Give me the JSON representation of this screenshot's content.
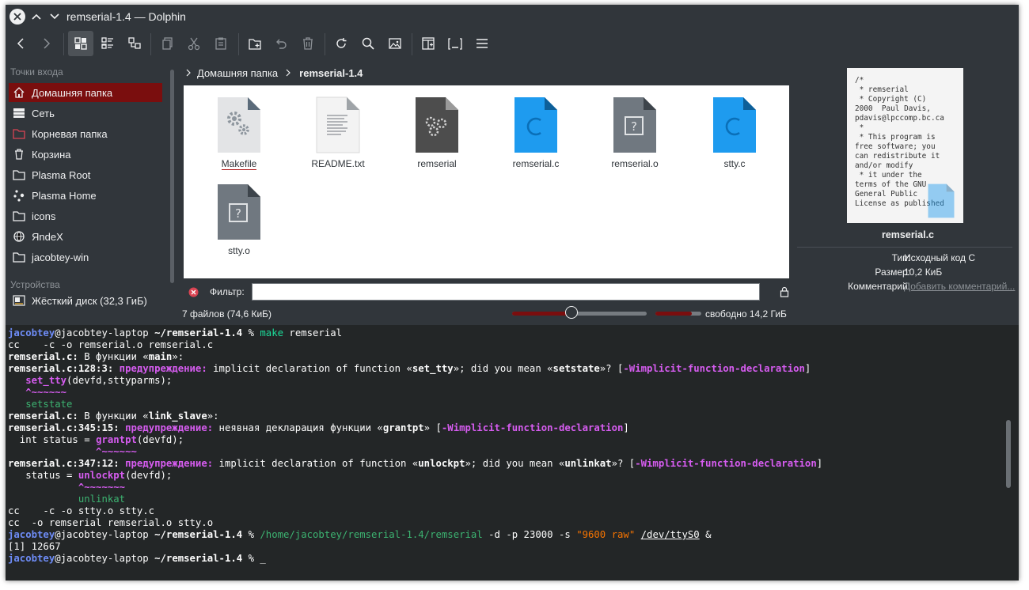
{
  "window": {
    "title": "remserial-1.4 — Dolphin"
  },
  "sidebar": {
    "places_header": "Точки входа",
    "places": [
      {
        "label": "Домашняя папка",
        "icon": "home-icon",
        "selected": true
      },
      {
        "label": "Сеть",
        "icon": "network-icon"
      },
      {
        "label": "Корневая папка",
        "icon": "root-folder-icon"
      },
      {
        "label": "Корзина",
        "icon": "trash-icon"
      },
      {
        "label": "Plasma Root",
        "icon": "folder-icon"
      },
      {
        "label": "Plasma Home",
        "icon": "plasma-icon"
      },
      {
        "label": "icons",
        "icon": "folder-icon"
      },
      {
        "label": "ЯndeX",
        "icon": "network-folder-icon"
      },
      {
        "label": "jacobtey-win",
        "icon": "folder-icon"
      }
    ],
    "devices_header": "Устройства",
    "devices": [
      {
        "label": "Жёсткий диск (32,3 ГиБ)",
        "icon": "hard-disk-icon"
      }
    ]
  },
  "breadcrumb": {
    "items": [
      "Домашняя папка",
      "remserial-1.4"
    ]
  },
  "files": [
    {
      "name": "Makefile",
      "icon": "makefile-icon"
    },
    {
      "name": "README.txt",
      "icon": "text-file-icon"
    },
    {
      "name": "remserial",
      "icon": "executable-icon"
    },
    {
      "name": "remserial.c",
      "icon": "c-source-icon"
    },
    {
      "name": "remserial.o",
      "icon": "unknown-file-icon"
    },
    {
      "name": "stty.c",
      "icon": "c-source-icon"
    },
    {
      "name": "stty.o",
      "icon": "unknown-file-icon"
    }
  ],
  "filter": {
    "label": "Фильтр:",
    "value": ""
  },
  "status": {
    "summary": "7 файлов (74,6 КиБ)",
    "free": "свободно 14,2 ГиБ",
    "zoom_fraction": 0.44
  },
  "info": {
    "preview_text": "/*\n * remserial\n * Copyright (C)\n2000  Paul Davis,\npdavis@lpccomp.bc.ca\n *\n * This program is\nfree software; you\ncan redistribute it\nand/or modify\n * it under the\nterms of the GNU\nGeneral Public\nLicense as published",
    "filename": "remserial.c",
    "rows": [
      {
        "label": "Тип:",
        "value": "Исходный код C"
      },
      {
        "label": "Размер:",
        "value": "10,2 КиБ"
      },
      {
        "label": "Комментарий:",
        "value": "Добавить комментарий..."
      }
    ]
  },
  "terminal": {
    "user": "jacobtey",
    "host": "@jacobtey-laptop",
    "dir": "~/remserial-1.4",
    "cmd1": "make",
    "cmd1_arg": " remserial",
    "lines": [
      "cc    -c -o remserial.o remserial.c",
      "remserial.c:",
      " В функции «",
      "main",
      "»:",
      "remserial.c:128:3:",
      " предупреждение:",
      " implicit declaration of function «",
      "set_tty",
      "»; did you mean «",
      "setstate",
      "»? [",
      "-Wimplicit-function-declaration",
      "]",
      "   ",
      "set_tty",
      "(devfd,sttyparms);",
      "   ^~~~~~~",
      "   setstate",
      "remserial.c:",
      " В функции «",
      "link_slave",
      "»:",
      "remserial.c:345:15:",
      " предупреждение:",
      " неявная декларация функции «",
      "grantpt",
      "» [",
      "-Wimplicit-function-declaration",
      "]",
      "  int status = ",
      "grantpt",
      "(devfd);",
      "               ^~~~~~~",
      "remserial.c:347:12:",
      " предупреждение:",
      " implicit declaration of function «",
      "unlockpt",
      "»; did you mean «",
      "unlinkat",
      "»? [",
      "-Wimplicit-function-declaration",
      "]",
      "   status = ",
      "unlockpt",
      "(devfd);",
      "            ^~~~~~~~",
      "            unlinkat",
      "cc    -c -o stty.o stty.c",
      "cc  -o remserial remserial.o stty.o",
      "/home/jacobtey/remserial-1.4/remserial",
      " -d -p 23000 -s ",
      "\"9600 raw\"",
      "/dev/ttyS0",
      " &",
      "[1] 12667",
      " % "
    ]
  }
}
